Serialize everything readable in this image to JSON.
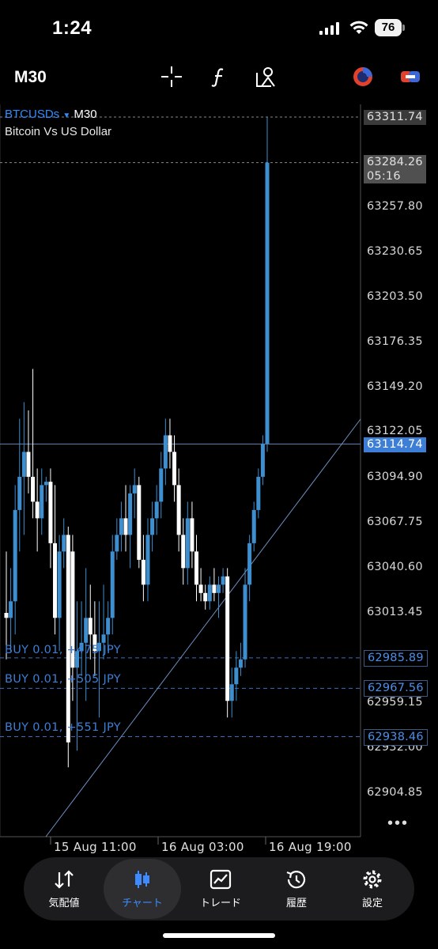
{
  "status_bar": {
    "time": "1:24",
    "battery": "76"
  },
  "toolbar": {
    "timeframe": "M30",
    "icons": [
      "crosshair-icon",
      "function-icon",
      "objects-icon",
      "trading-signals-icon",
      "link-icon"
    ]
  },
  "chart": {
    "symbol": "BTCUSDs",
    "timeframe": "M30",
    "description": "Bitcoin Vs US Dollar",
    "price_ticks": [
      "63257.80",
      "63230.65",
      "63203.50",
      "63176.35",
      "63149.20",
      "63122.05",
      "63094.90",
      "63067.75",
      "63040.60",
      "63013.45",
      "62959.15",
      "62932.00",
      "62904.85"
    ],
    "price_labels": {
      "high": "63311.74",
      "current_price": "63284.26",
      "countdown": "05:16",
      "bid": "63114.74",
      "order1": "62985.89",
      "order2": "62967.56",
      "order3": "62938.46"
    },
    "orders": [
      "BUY 0.01, +475 JPY",
      "BUY 0.01, +505 JPY",
      "BUY 0.01, +551 JPY"
    ],
    "time_labels": [
      "15 Aug 11:00",
      "16 Aug 03:00",
      "16 Aug 19:00"
    ],
    "colors": {
      "bull": "#3d8fd0",
      "bear": "#ffffff",
      "accent": "#3d8bff"
    }
  },
  "chart_data": {
    "type": "candlestick",
    "symbol": "BTCUSDs",
    "timeframe": "M30",
    "title": "BTCUSDs M30",
    "subtitle": "Bitcoin Vs US Dollar",
    "x_tick_labels": [
      "15 Aug 11:00",
      "16 Aug 03:00",
      "16 Aug 19:00"
    ],
    "ylim": [
      62885.0,
      63325.0
    ],
    "ohlc": [
      [
        63013,
        63050,
        62985,
        63010
      ],
      [
        63010,
        63040,
        62990,
        63020
      ],
      [
        63020,
        63090,
        63000,
        63075
      ],
      [
        63075,
        63130,
        63050,
        63095
      ],
      [
        63095,
        63140,
        63060,
        63110
      ],
      [
        63110,
        63135,
        63085,
        63095
      ],
      [
        63095,
        63160,
        63070,
        63080
      ],
      [
        63080,
        63100,
        63050,
        63070
      ],
      [
        63070,
        63100,
        63060,
        63090
      ],
      [
        63090,
        63095,
        63080,
        63092
      ],
      [
        63092,
        63100,
        63040,
        63055
      ],
      [
        63055,
        63090,
        63000,
        63010
      ],
      [
        63010,
        63060,
        62990,
        63050
      ],
      [
        63050,
        63070,
        63040,
        63060
      ],
      [
        63060,
        63065,
        62920,
        62935
      ],
      [
        63050,
        63060,
        62960,
        62980
      ],
      [
        62980,
        63020,
        62930,
        62990
      ],
      [
        62990,
        63020,
        62975,
        62995
      ],
      [
        62995,
        63040,
        62960,
        63010
      ],
      [
        63010,
        63030,
        62985,
        63000
      ],
      [
        63000,
        63020,
        62975,
        62990
      ],
      [
        62990,
        63020,
        62950,
        62995
      ],
      [
        62995,
        63030,
        62985,
        63000
      ],
      [
        63000,
        63020,
        62990,
        63010
      ],
      [
        63010,
        63060,
        63000,
        63050
      ],
      [
        63050,
        63070,
        63045,
        63060
      ],
      [
        63060,
        63080,
        63050,
        63070
      ],
      [
        63070,
        63090,
        63050,
        63060
      ],
      [
        63060,
        63090,
        63040,
        63085
      ],
      [
        63085,
        63100,
        63070,
        63090
      ],
      [
        63090,
        63095,
        63040,
        63045
      ],
      [
        63045,
        63060,
        63020,
        63030
      ],
      [
        63030,
        63070,
        63020,
        63060
      ],
      [
        63060,
        63080,
        63050,
        63070
      ],
      [
        63070,
        63090,
        63060,
        63080
      ],
      [
        63080,
        63110,
        63070,
        63100
      ],
      [
        63100,
        63130,
        63090,
        63120
      ],
      [
        63120,
        63130,
        63100,
        63110
      ],
      [
        63110,
        63120,
        63080,
        63090
      ],
      [
        63090,
        63100,
        63050,
        63060
      ],
      [
        63060,
        63070,
        63030,
        63040
      ],
      [
        63040,
        63080,
        63030,
        63070
      ],
      [
        63070,
        63080,
        63040,
        63050
      ],
      [
        63050,
        63060,
        63020,
        63030
      ],
      [
        63030,
        63040,
        63020,
        63025
      ],
      [
        63025,
        63030,
        63015,
        63020
      ],
      [
        63020,
        63035,
        63015,
        63030
      ],
      [
        63030,
        63040,
        63020,
        63025
      ],
      [
        63025,
        63035,
        63010,
        63030
      ],
      [
        63030,
        63040,
        63025,
        63035
      ],
      [
        63035,
        63040,
        62950,
        62960
      ],
      [
        62960,
        62980,
        62950,
        62970
      ],
      [
        62970,
        62990,
        62960,
        62980
      ],
      [
        62980,
        62995,
        62975,
        62985
      ],
      [
        62985,
        63040,
        62980,
        63030
      ],
      [
        63030,
        63060,
        63020,
        63055
      ],
      [
        63055,
        63080,
        63050,
        63075
      ],
      [
        63075,
        63100,
        63070,
        63095
      ],
      [
        63095,
        63120,
        63090,
        63115
      ],
      [
        63115,
        63311.74,
        63110,
        63284.26
      ]
    ],
    "horizontal_lines": [
      63311.74,
      63284.26,
      63114.74,
      62985.89,
      62967.56,
      62938.46
    ]
  },
  "nav": {
    "items": [
      {
        "label": "気配値",
        "icon": "quotes-arrows-icon"
      },
      {
        "label": "チャート",
        "icon": "chart-candles-icon"
      },
      {
        "label": "トレード",
        "icon": "trade-chart-icon"
      },
      {
        "label": "履歴",
        "icon": "history-clock-icon"
      },
      {
        "label": "設定",
        "icon": "settings-gear-icon"
      }
    ]
  }
}
